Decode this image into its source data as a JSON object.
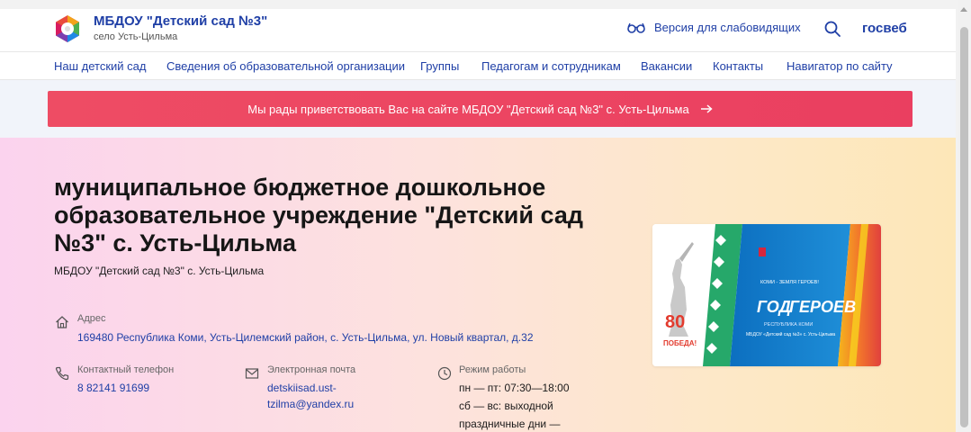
{
  "header": {
    "title": "МБДОУ \"Детский сад №3\"",
    "subtitle": "село Усть-Цильма",
    "accessibility_label": "Версия для слабовидящих",
    "gosweb_label": "госвеб"
  },
  "nav": {
    "items": [
      {
        "label": "Наш детский сад"
      },
      {
        "label": "Сведения об образовательной организации"
      },
      {
        "label": "Группы"
      },
      {
        "label": "Педагогам и сотрудникам"
      },
      {
        "label": "Вакансии"
      },
      {
        "label": "Контакты"
      },
      {
        "label": "Навигатор по сайту"
      }
    ]
  },
  "welcome": {
    "text": "Мы рады приветствовать Вас на сайте МБДОУ \"Детский сад №3\" с. Усть-Цильма"
  },
  "hero": {
    "org_name": "муниципальное бюджетное дошкольное образовательное учреждение \"Детский сад №3\" с. Усть-Цильма",
    "org_short": "МБДОУ \"Детский сад №3\" с. Усть-Цильма",
    "address_label": "Адрес",
    "address_value": "169480 Республика Коми, Усть-Цилемский район, с. Усть-Цильма, ул. Новый квартал, д.32",
    "phone_label": "Контактный телефон",
    "phone_value": "8 82141 91699",
    "email_label": "Электронная почта",
    "email_value_1": "detskiisad.ust-",
    "email_value_2": "tzilma@yandex.ru",
    "hours_label": "Режим работы",
    "hours_lines": [
      "пн — пт: 07:30—18:00",
      "сб — вс: выходной",
      "праздничные дни —"
    ]
  },
  "banner": {
    "caption_top": "КОМИ - ЗЕМЛЯ ГЕРОЕВ!",
    "word_god": "ГОД",
    "word_geroev": "ГЕРОЕВ",
    "republic": "РЕСПУБЛИКА КОМИ",
    "kindergarten": "МБДОУ «Детский сад №3» с. Усть-Цильма",
    "eighty": "80",
    "pobeda": "ПОБЕДА!"
  },
  "colors": {
    "brand_blue": "#1f3fa6",
    "welcome_red": "#ea3f60",
    "banner_blue": "#1f74c8"
  }
}
